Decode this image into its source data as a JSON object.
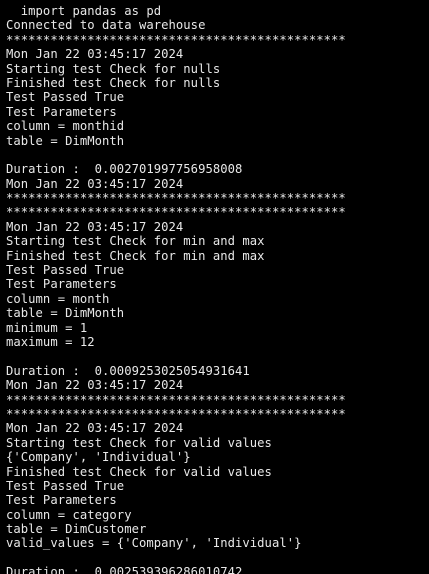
{
  "terminal": {
    "lines": [
      "  import pandas as pd",
      "Connected to data warehouse",
      "**********************************************",
      "Mon Jan 22 03:45:17 2024",
      "Starting test Check for nulls",
      "Finished test Check for nulls",
      "Test Passed True",
      "Test Parameters",
      "column = monthid",
      "table = DimMonth",
      "",
      "Duration :  0.002701997756958008",
      "Mon Jan 22 03:45:17 2024",
      "**********************************************",
      "**********************************************",
      "Mon Jan 22 03:45:17 2024",
      "Starting test Check for min and max",
      "Finished test Check for min and max",
      "Test Passed True",
      "Test Parameters",
      "column = month",
      "table = DimMonth",
      "minimum = 1",
      "maximum = 12",
      "",
      "Duration :  0.0009253025054931641",
      "Mon Jan 22 03:45:17 2024",
      "**********************************************",
      "**********************************************",
      "Mon Jan 22 03:45:17 2024",
      "Starting test Check for valid values",
      "{'Company', 'Individual'}",
      "Finished test Check for valid values",
      "Test Passed True",
      "Test Parameters",
      "column = category",
      "table = DimCustomer",
      "valid_values = {'Company', 'Individual'}",
      "",
      "Duration :  0.002539396286010742"
    ]
  },
  "colors": {
    "background": "#000000",
    "text": "#e8e8e8"
  }
}
